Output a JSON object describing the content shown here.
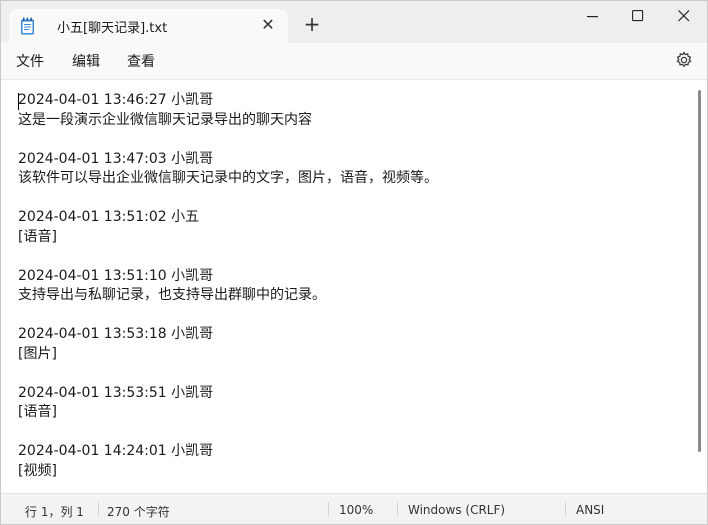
{
  "tab": {
    "title": "小五[聊天记录].txt",
    "close_symbol": "✕",
    "new_tab_symbol": "+"
  },
  "window_controls": {
    "minimize": "—",
    "maximize": "☐",
    "close": "✕"
  },
  "menu": {
    "file": "文件",
    "edit": "编辑",
    "view": "查看"
  },
  "document": {
    "entries": [
      {
        "header": "2024-04-01 13:46:27 小凯哥",
        "body": "这是一段演示企业微信聊天记录导出的聊天内容"
      },
      {
        "header": "2024-04-01 13:47:03 小凯哥",
        "body": "该软件可以导出企业微信聊天记录中的文字，图片，语音，视频等。"
      },
      {
        "header": "2024-04-01 13:51:02 小五",
        "body": "[语音]"
      },
      {
        "header": "2024-04-01 13:51:10 小凯哥",
        "body": "支持导出与私聊记录，也支持导出群聊中的记录。"
      },
      {
        "header": "2024-04-01 13:53:18 小凯哥",
        "body": "[图片]"
      },
      {
        "header": "2024-04-01 13:53:51 小凯哥",
        "body": "[语音]"
      },
      {
        "header": "2024-04-01 14:24:01 小凯哥",
        "body": "[视频]"
      }
    ]
  },
  "status": {
    "position": "行 1，列 1",
    "char_count": "270 个字符",
    "zoom": "100%",
    "line_ending": "Windows (CRLF)",
    "encoding": "ANSI"
  },
  "icons": {
    "notepad": "notepad-icon",
    "settings": "gear-icon"
  }
}
